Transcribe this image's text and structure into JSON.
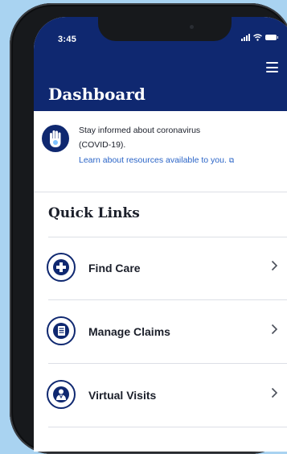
{
  "status_bar": {
    "time": "3:45"
  },
  "header": {
    "title": "Dashboard"
  },
  "alert": {
    "line1": "Stay informed about coronavirus",
    "line2": "(COVID-19).",
    "link": "Learn about resources available to you."
  },
  "quick_links": {
    "heading": "Quick Links",
    "items": [
      {
        "label": "Find Care",
        "icon": "plus-icon"
      },
      {
        "label": "Manage Claims",
        "icon": "document-icon"
      },
      {
        "label": "Virtual Visits",
        "icon": "doctor-icon"
      }
    ]
  },
  "colors": {
    "background": "#a9d3f1",
    "header": "#0f2870",
    "link": "#2a64c7",
    "text": "#1b1f2a"
  }
}
